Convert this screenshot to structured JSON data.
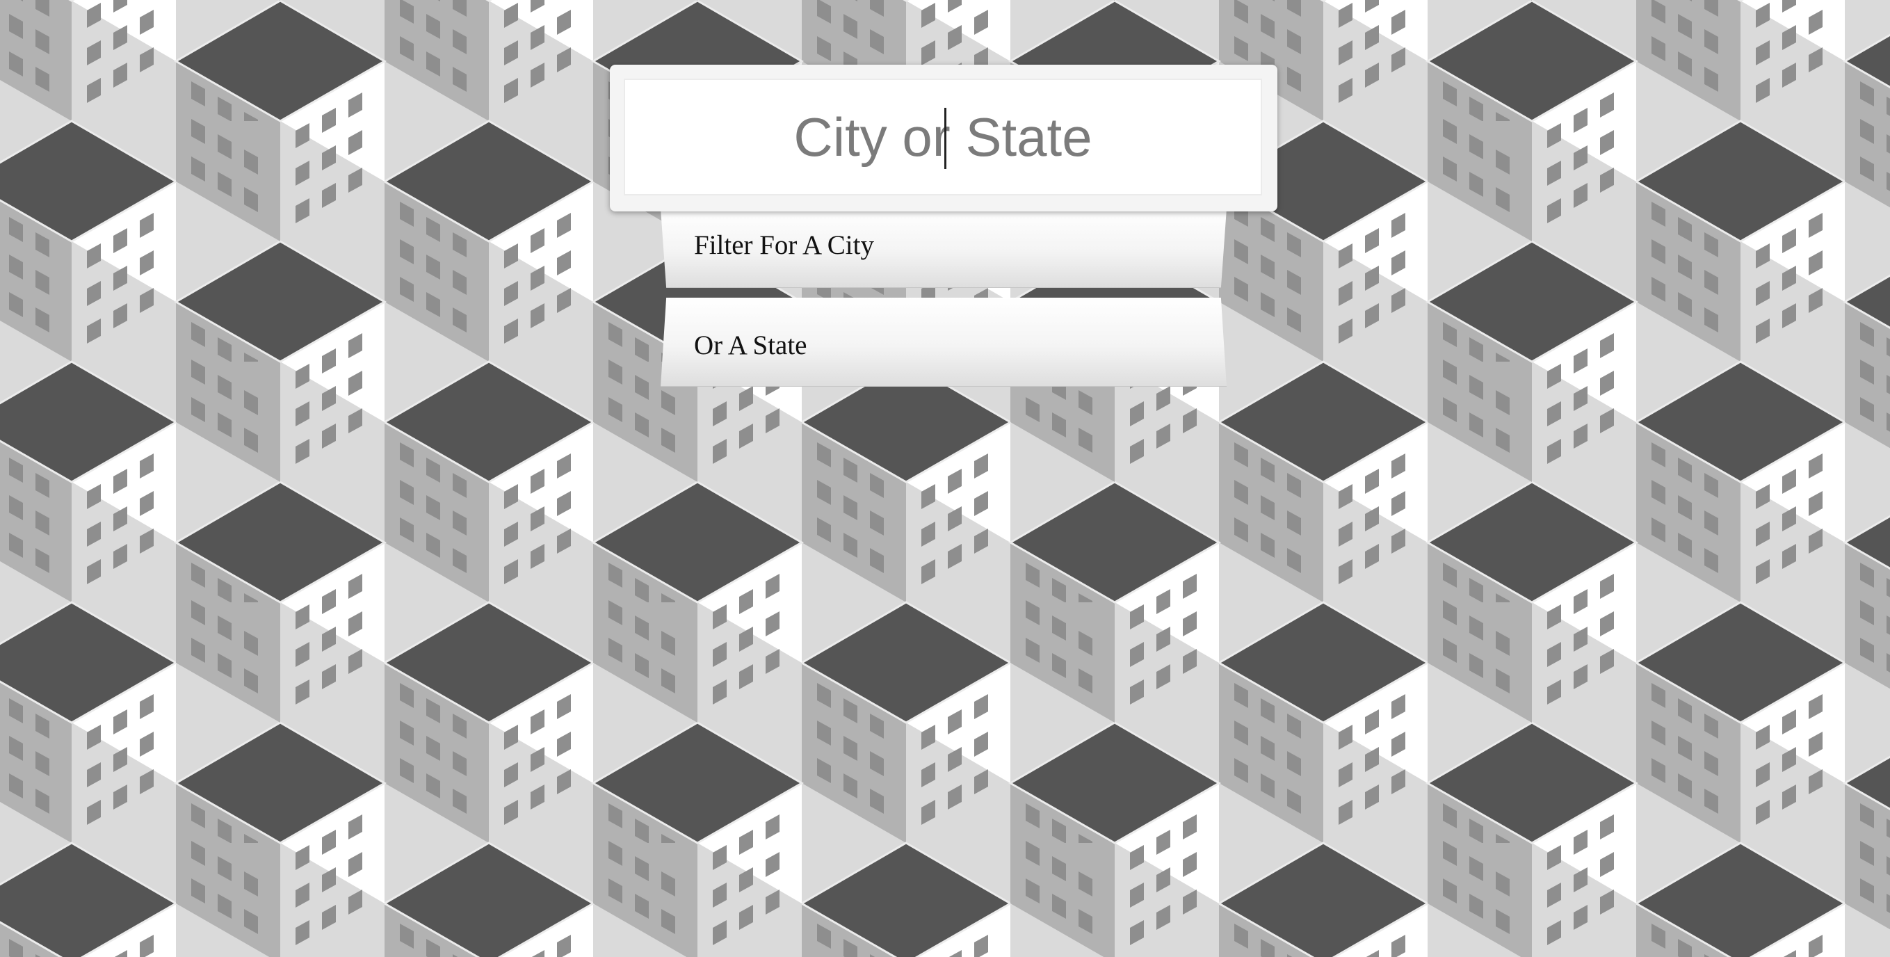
{
  "search": {
    "placeholder": "City or State",
    "value": ""
  },
  "suggestions": [
    {
      "label": "Filter For A City"
    },
    {
      "label": "Or A State"
    }
  ],
  "colors": {
    "roof": "#555555",
    "wall_light": "#ffffff",
    "wall_shade": "#b0b0b0",
    "window": "#8e8e8e",
    "box_background": "#f4f4f4"
  },
  "icons": {
    "background": "isometric-buildings-pattern"
  }
}
